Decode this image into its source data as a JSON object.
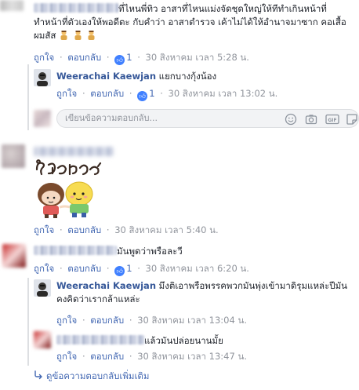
{
  "actions": {
    "like": "ถูกใจ",
    "reply": "ตอบกลับ",
    "sep": "·"
  },
  "comment1": {
    "line1": "ที่ไหนพี่ทิว อาสาที่ไหนแม่งจัดชุดใหญ่ให้ทีทำเกินหน้าที่",
    "line2": "ทำหน้าที่ตัวเองให้พอดีตะ กับคำว่า อาสาตำรวจ เค้าไม่ได้ให้อำนาจมาซาก คอเสื้อ",
    "line3": "ผมสัส",
    "likes": "1",
    "date": "30 สิงหาคม เวลา 5:28 น."
  },
  "reply1": {
    "author": "Weerachai Kaewjan",
    "text": "แยกบางกุ้งน้อง",
    "likes": "1",
    "date": "30 สิงหาคม เวลา 13:02 น."
  },
  "reply_box": {
    "placeholder": "เขียนข้อความตอบกลับ..."
  },
  "comment2": {
    "sticker_text": "ใจเย็นๆ",
    "date": "30 สิงหาคม เวลา 5:40 น."
  },
  "comment3": {
    "text": "มันพูดว่าพรือละวี",
    "likes": "1",
    "date": "30 สิงหาคม เวลา 6:20 น."
  },
  "reply2": {
    "author": "Weerachai Kaewjan",
    "text_line1": "มึงติเอาพรือพรรคพวกมันพุ่งเข้ามาดิรุมแหล่ะปีมัน",
    "text_line2": "คงคิดว่าเรากล้าแหล่ะ",
    "date": "30 สิงหาคม เวลา 13:04 น."
  },
  "reply3": {
    "text": "แล้วมันปล่อยนานมั้ย",
    "date": "30 สิงหาคม เวลา 13:47 น."
  },
  "more_replies": {
    "label": "ดูข้อความตอบกลับเพิ่มเติม"
  },
  "colors": {
    "name": "#365899",
    "link": "#4267b2",
    "meta": "#90949c",
    "like_badge": "#4080ff"
  }
}
